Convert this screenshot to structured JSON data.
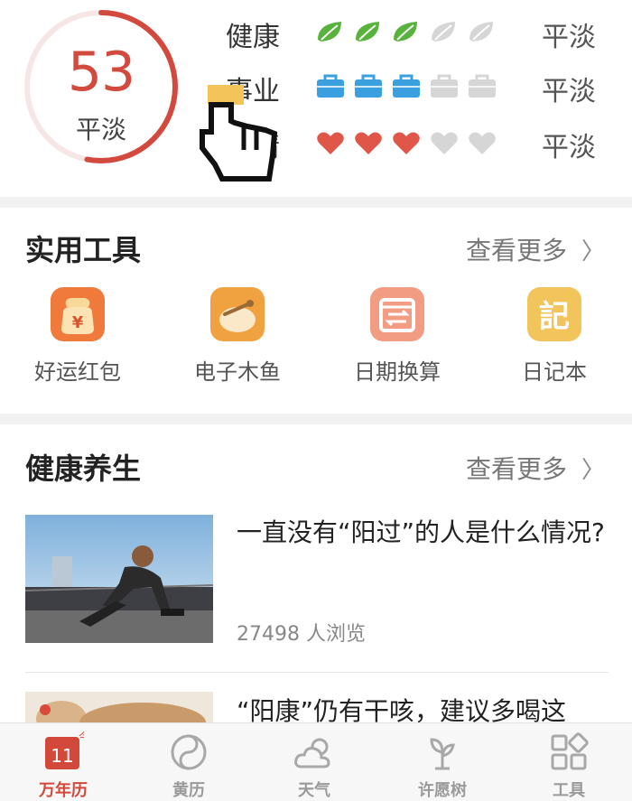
{
  "fortune": {
    "score": "53",
    "score_label": "平淡",
    "score_fraction": 0.53,
    "rows": [
      {
        "label": "健康",
        "icon": "leaf-icon",
        "filled": 3,
        "total": 5,
        "level": "平淡",
        "color": "#57b33c"
      },
      {
        "label": "事业",
        "icon": "briefcase-icon",
        "filled": 3,
        "total": 5,
        "level": "平淡",
        "color": "#3aa0e0"
      },
      {
        "label": "爱情",
        "icon": "heart-icon",
        "filled": 3,
        "total": 5,
        "level": "平淡",
        "color": "#e0574a"
      }
    ]
  },
  "tools": {
    "title": "实用工具",
    "more": "查看更多",
    "items": [
      {
        "label": "好运红包",
        "icon": "lucky-money-bag-icon"
      },
      {
        "label": "电子木鱼",
        "icon": "wooden-fish-icon"
      },
      {
        "label": "日期换算",
        "icon": "date-convert-icon"
      },
      {
        "label": "日记本",
        "icon": "diary-icon"
      }
    ]
  },
  "health": {
    "title": "健康养生",
    "more": "查看更多",
    "articles": [
      {
        "title": "一直没有“阳过”的人是什么情况?",
        "views": "27498 人浏览"
      },
      {
        "title": "“阳康”仍有干咳，建议多喝这"
      }
    ]
  },
  "tabbar": {
    "items": [
      {
        "label": "万年历",
        "icon": "calendar-icon",
        "badge": "11",
        "active": true
      },
      {
        "label": "黄历",
        "icon": "yin-yang-icon",
        "active": false
      },
      {
        "label": "天气",
        "icon": "weather-icon",
        "active": false
      },
      {
        "label": "许愿树",
        "icon": "wish-tree-icon",
        "active": false
      },
      {
        "label": "工具",
        "icon": "tools-grid-icon",
        "active": false
      }
    ]
  },
  "colors": {
    "accent": "#d24a3e",
    "gray_icon": "#d6d6d6"
  }
}
